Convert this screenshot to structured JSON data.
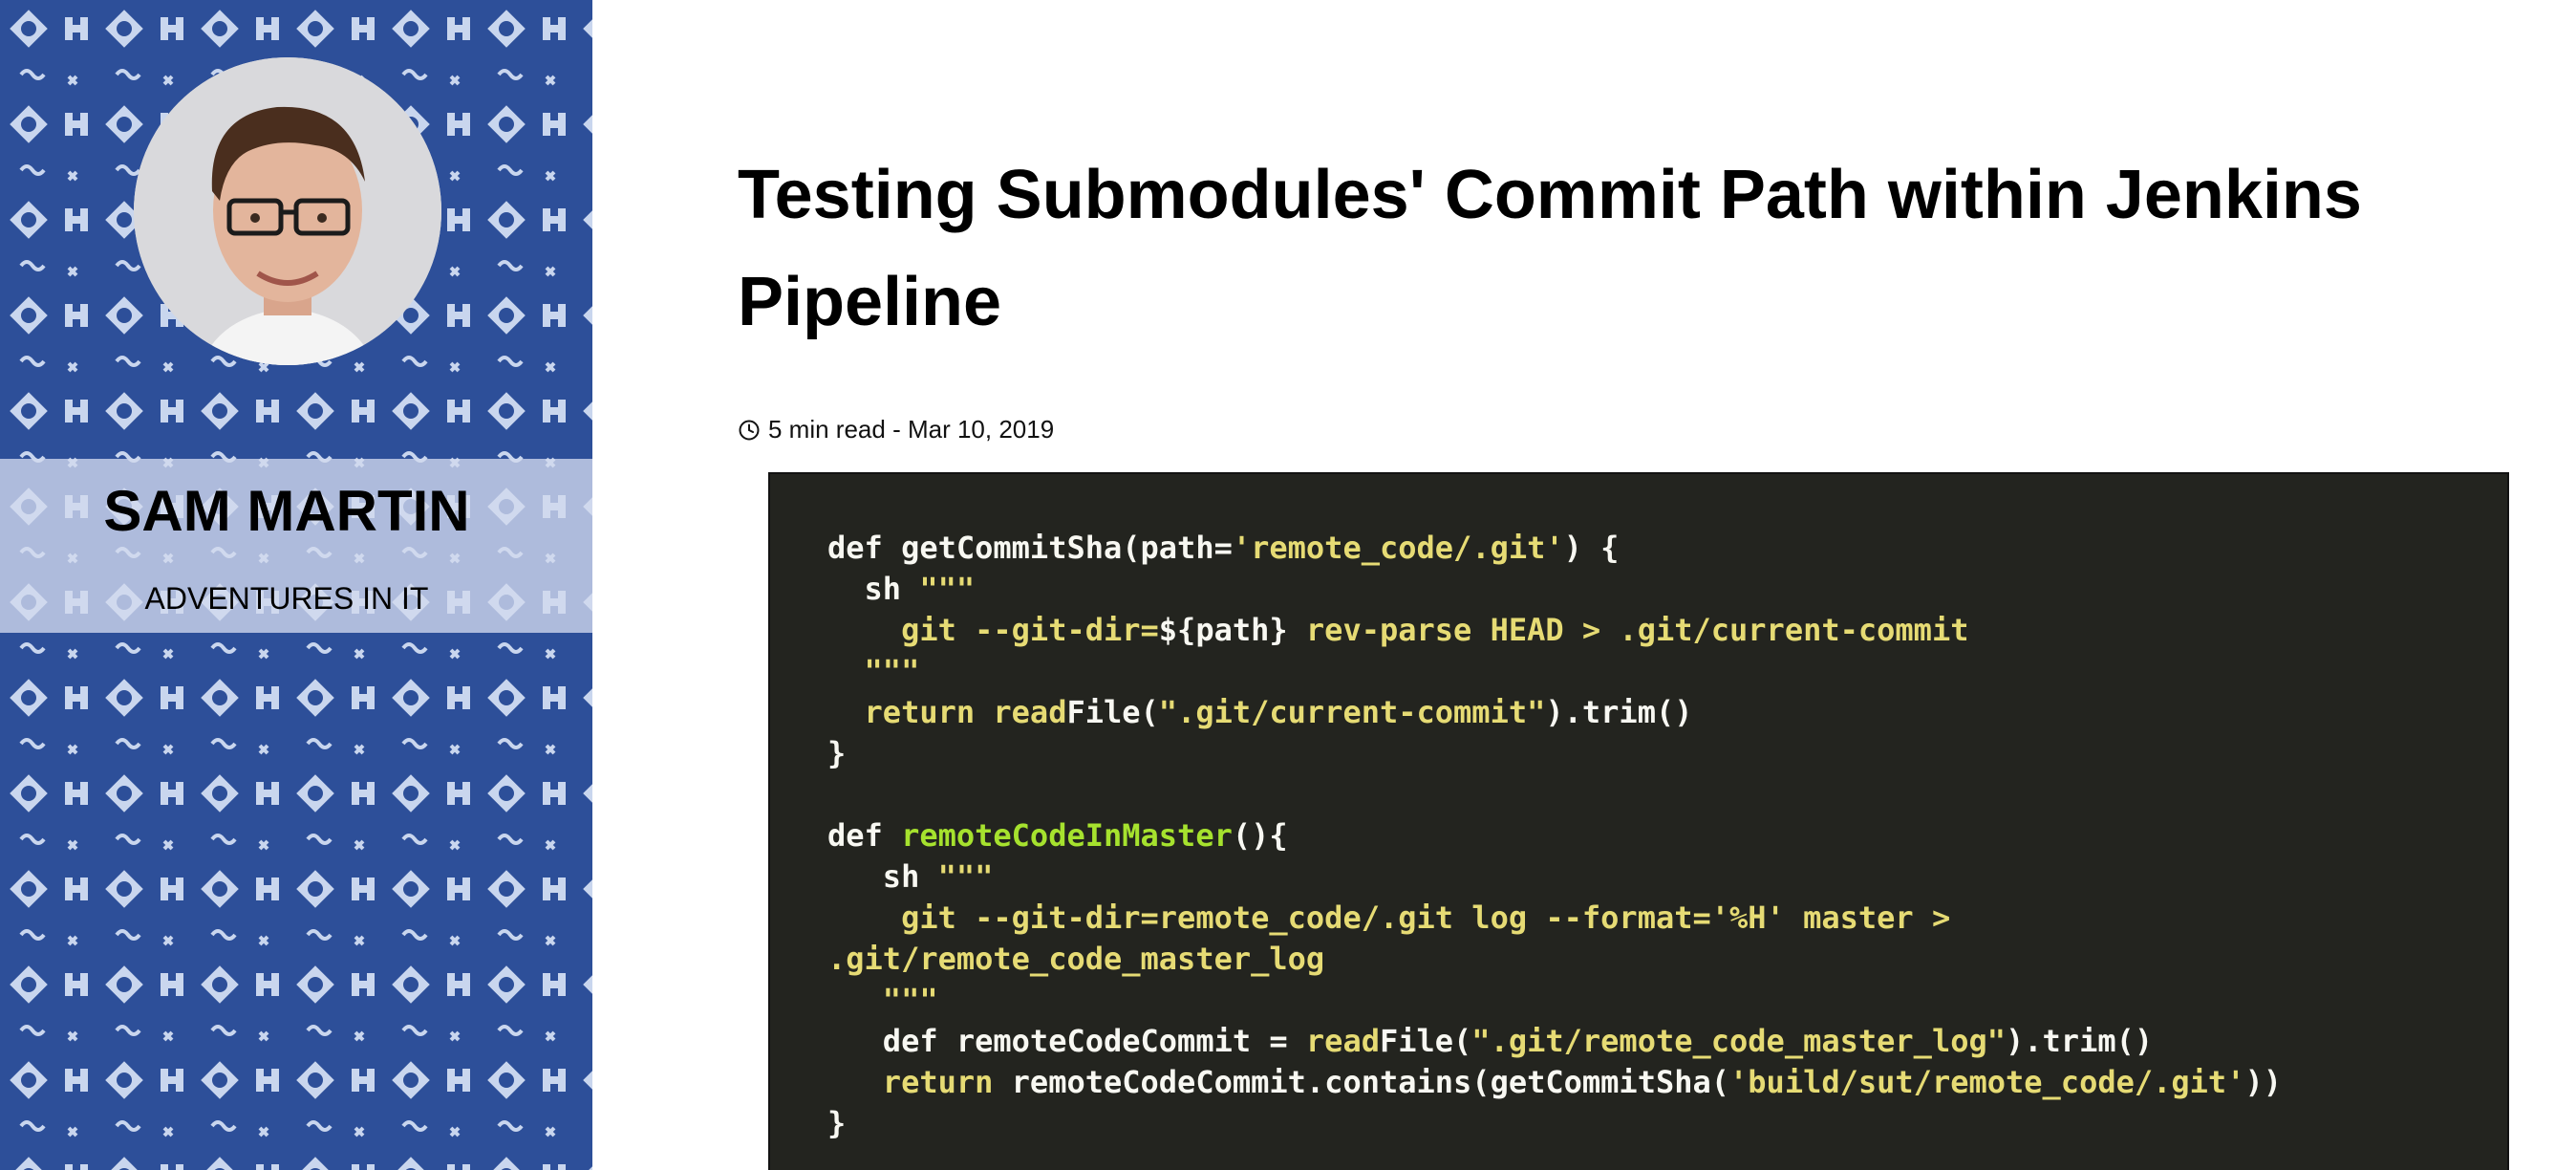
{
  "sidebar": {
    "name": "SAM MARTIN",
    "tagline": "ADVENTURES IN IT",
    "pattern_color": "#2d4f99",
    "avatar_icon": "avatar-photo"
  },
  "post": {
    "title": "Testing Submodules' Commit Path within Jenkins Pipeline",
    "meta": "5 min read - Mar 10, 2019"
  },
  "code": {
    "l1a": "def getCommitSha(path=",
    "l1b": "'remote_code/.git'",
    "l1c": ") {",
    "l2a": "  sh ",
    "l2b": "\"\"\"",
    "l3a": "    git --git-dir=",
    "l3b": "${path}",
    "l3c": " rev-parse HEAD > .git/current-commit",
    "l4": "  \"\"\"",
    "l5a": "  return ",
    "l5b": "read",
    "l5c": "File(",
    "l5d": "\".git/current-commit\"",
    "l5e": ").trim()",
    "l6": "}",
    "l7a": "def ",
    "l7b": "remoteCodeInMaster",
    "l7c": "(){",
    "l8a": "   sh ",
    "l8b": "\"\"\"",
    "l9": "    git --git-dir=remote_code/.git log --format='%H' master >",
    "l10": ".git/remote_code_master_log",
    "l11": "   \"\"\"",
    "l12a": "   def remoteCodeCommit = ",
    "l12b": "read",
    "l12c": "File(",
    "l12d": "\".git/remote_code_master_log\"",
    "l12e": ").trim()",
    "l13a": "   return ",
    "l13b": "remoteCodeCommit.contains(getCommitSha(",
    "l13c": "'build/sut/remote_code/.git'",
    "l13d": "))",
    "l14": "}"
  }
}
